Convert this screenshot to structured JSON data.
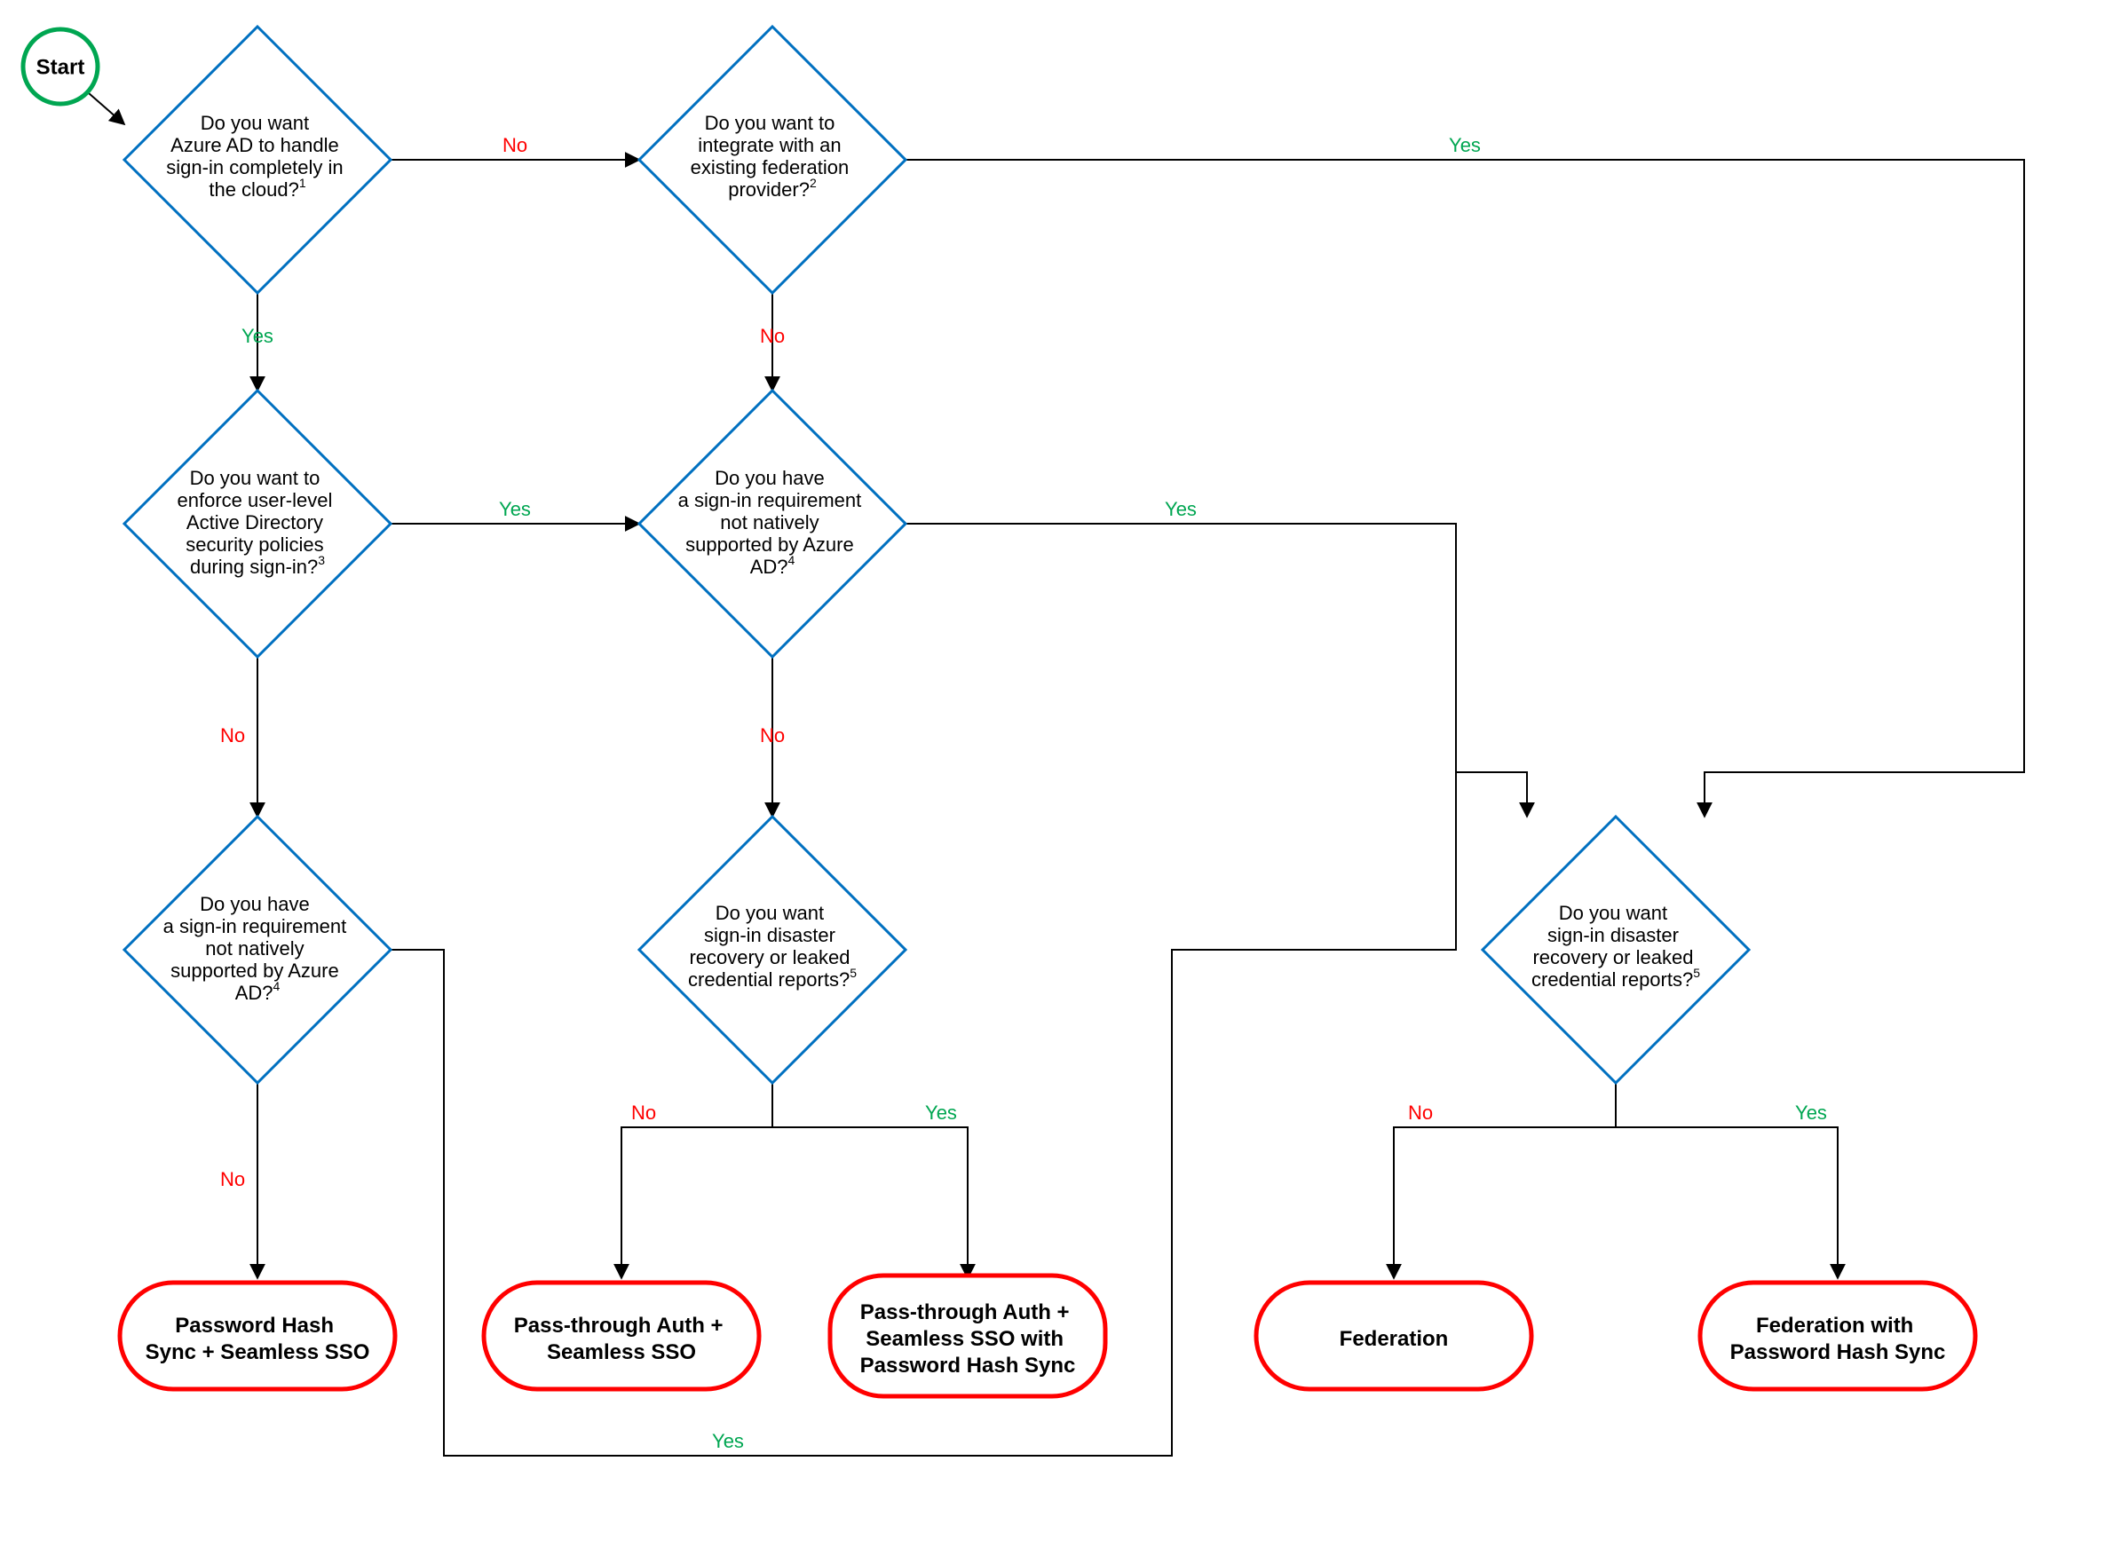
{
  "start": {
    "label": "Start"
  },
  "labels": {
    "yes": "Yes",
    "no": "No"
  },
  "decisions": {
    "d1": {
      "lines": [
        "Do you want",
        "Azure AD to handle",
        "sign-in completely in",
        "the cloud?"
      ],
      "sup": "1"
    },
    "d2": {
      "lines": [
        "Do you want to",
        "integrate with an",
        "existing federation",
        "provider?"
      ],
      "sup": "2"
    },
    "d3": {
      "lines": [
        "Do you want to",
        "enforce user-level",
        "Active Directory",
        "security policies",
        "during sign-in?"
      ],
      "sup": "3"
    },
    "d4": {
      "lines": [
        "Do you have",
        "a sign-in requirement",
        "not natively",
        "supported by Azure",
        "AD?"
      ],
      "sup": "4"
    },
    "d5": {
      "lines": [
        "Do you have",
        "a sign-in requirement",
        "not natively",
        "supported by Azure",
        "AD?"
      ],
      "sup": "4"
    },
    "d6": {
      "lines": [
        "Do you want",
        "sign-in disaster",
        "recovery or leaked",
        "credential reports?"
      ],
      "sup": "5"
    },
    "d7": {
      "lines": [
        "Do you want",
        "sign-in disaster",
        "recovery or leaked",
        "credential reports?"
      ],
      "sup": "5"
    }
  },
  "terminators": {
    "t1": {
      "lines": [
        "Password Hash",
        "Sync + Seamless SSO"
      ]
    },
    "t2": {
      "lines": [
        "Pass-through Auth +",
        "Seamless SSO"
      ]
    },
    "t3": {
      "lines": [
        "Pass-through Auth +",
        "Seamless SSO with",
        "Password Hash Sync"
      ]
    },
    "t4": {
      "lines": [
        "Federation"
      ]
    },
    "t5": {
      "lines": [
        "Federation with",
        "Password Hash Sync"
      ]
    }
  }
}
